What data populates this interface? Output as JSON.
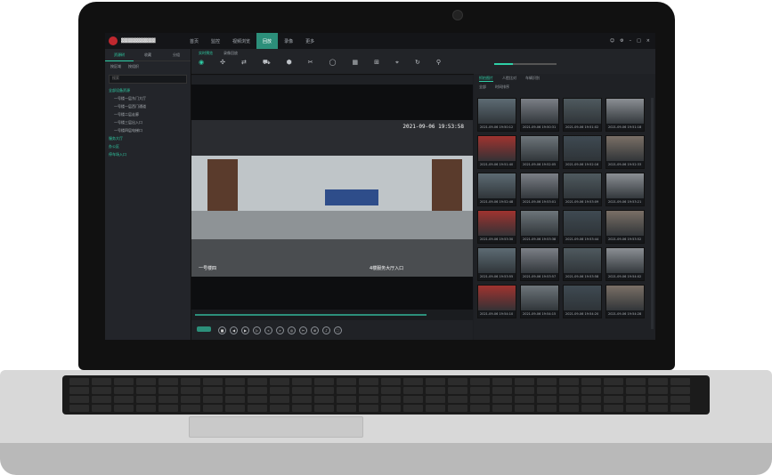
{
  "app": {
    "nav_tabs": [
      "首页",
      "监控",
      "视频浏览",
      "回放",
      "录像",
      "更多"
    ],
    "active_tab_index": 3
  },
  "left_panel": {
    "tabs": [
      "资源树",
      "收藏",
      "分组"
    ],
    "subtabs": [
      "按区域",
      "按组织"
    ],
    "search_placeholder": "搜索",
    "tree": [
      {
        "label": "全部设备资源",
        "type": "grp"
      },
      {
        "label": "一号楼一层东门大厅",
        "type": "sub"
      },
      {
        "label": "一号楼一层西门通道",
        "type": "sub"
      },
      {
        "label": "一号楼二层走廊",
        "type": "sub"
      },
      {
        "label": "一号楼三层出入口",
        "type": "sub"
      },
      {
        "label": "一号楼四层电梯口",
        "type": "sub"
      },
      {
        "label": "服务大厅",
        "type": "grp"
      },
      {
        "label": "办公区",
        "type": "grp"
      },
      {
        "label": "停车场入口",
        "type": "grp"
      }
    ]
  },
  "toolbar": {
    "tabs": [
      "实时预览",
      "录像回放"
    ],
    "icons": [
      "◉",
      "✣",
      "⇄",
      "⛟",
      "⬢",
      "✂",
      "◯",
      "▦",
      "⊞",
      "⌖",
      "↻",
      "⚲"
    ]
  },
  "video": {
    "timestamp": "2021-09-06 19:53:58",
    "cam_label_left": "一号楼四",
    "cam_label_right": "4楼服务大厅入口"
  },
  "right_panel": {
    "tabs": [
      "抓拍图片",
      "人脸比对",
      "车辆识别"
    ],
    "filters": [
      "全部",
      "时间排序"
    ],
    "thumbs": [
      "2021-09-06 19:50:12",
      "2021-09-06 19:50:31",
      "2021-09-06 19:51:02",
      "2021-09-06 19:51:18",
      "2021-09-06 19:51:40",
      "2021-09-06 19:52:05",
      "2021-09-06 19:52:16",
      "2021-09-06 19:52:33",
      "2021-09-06 19:52:48",
      "2021-09-06 19:53:01",
      "2021-09-06 19:53:09",
      "2021-09-06 19:53:21",
      "2021-09-06 19:53:30",
      "2021-09-06 19:53:38",
      "2021-09-06 19:53:44",
      "2021-09-06 19:53:52",
      "2021-09-06 19:53:55",
      "2021-09-06 19:53:57",
      "2021-09-06 19:53:58",
      "2021-09-06 19:54:02",
      "2021-09-06 19:54:10",
      "2021-09-06 19:54:15",
      "2021-09-06 19:54:20",
      "2021-09-06 19:54:28"
    ]
  },
  "colors": {
    "accent": "#2fd0a7",
    "nav_active": "#2c8f7a"
  }
}
